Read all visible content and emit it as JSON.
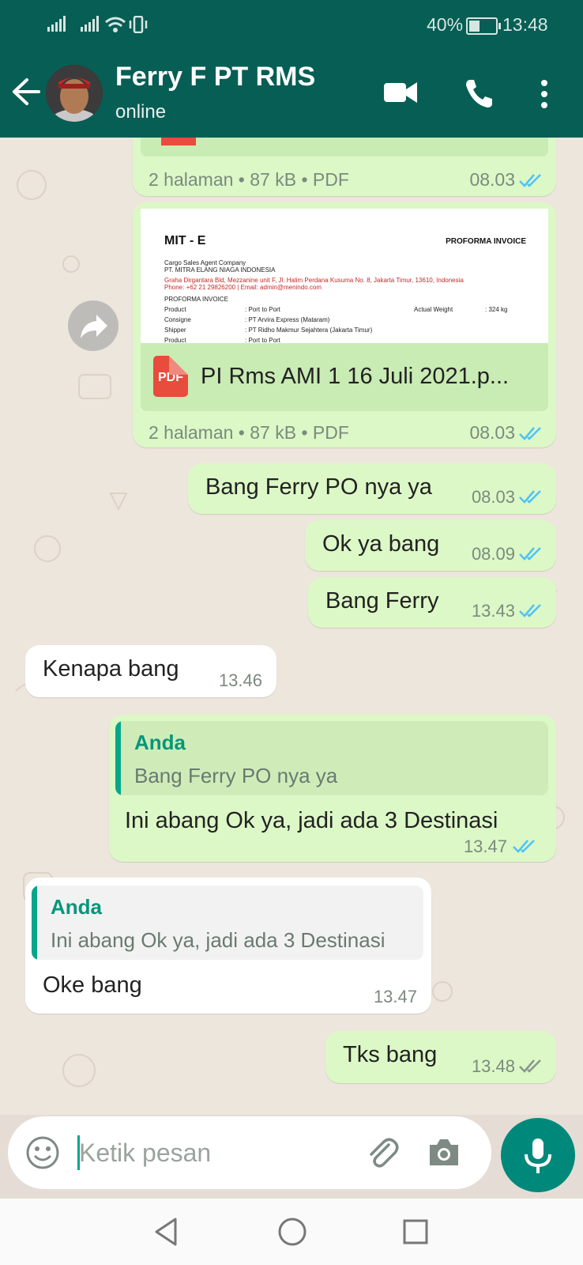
{
  "status_bar": {
    "battery": "40%",
    "time": "13:48",
    "battery_level": 0.4
  },
  "header": {
    "contact_name": "Ferry F PT RMS",
    "status": "online"
  },
  "messages": {
    "doc1": {
      "meta": "2 halaman • 87 kB • PDF",
      "time": "08.03"
    },
    "doc2": {
      "preview": {
        "logo": "MIT - E",
        "heading": "PROFORMA INVOICE",
        "line1": "Cargo Sales Agent Company",
        "line2": "PT. MITRA ELANG NIAGA INDONESIA",
        "address": "Graha Dirgantara Bld, Mezzanine unit F, Jl. Halim Perdana Kusuma No. 8, Jakarta Timur, 13610, Indonesia",
        "contact": "Phone: +62 21 29826200 | Email: admin@menindo.com",
        "subheading": "PROFORMA INVOICE",
        "rows": [
          {
            "label": "Product",
            "value": ": Port to Port"
          },
          {
            "label": "Consigne",
            "value": ": PT Arvira Express (Mataram)"
          },
          {
            "label": "Shipper",
            "value": ": PT Ridho Makmur Sejahtera (Jakarta Timur)"
          },
          {
            "label": "Product",
            "value": ": Port to Port"
          }
        ],
        "weight_label": "Actual Weight",
        "weight_value": ": 324 kg"
      },
      "pdf_label": "PDF",
      "filename": "PI Rms AMI 1 16 Juli 2021.p...",
      "meta": "2 halaman • 87 kB • PDF",
      "time": "08.03"
    },
    "m1": {
      "text": "Bang Ferry PO nya ya",
      "time": "08.03"
    },
    "m2": {
      "text": "Ok ya bang",
      "time": "08.09"
    },
    "m3": {
      "text": "Bang Ferry",
      "time": "13.43"
    },
    "m4": {
      "text": "Kenapa bang",
      "time": "13.46"
    },
    "m5": {
      "quote_author": "Anda",
      "quote_text": "Bang Ferry PO nya ya",
      "text": "Ini abang Ok ya, jadi ada 3 Destinasi",
      "time": "13.47"
    },
    "m6": {
      "quote_author": "Anda",
      "quote_text": "Ini abang Ok ya, jadi ada 3 Destinasi",
      "text": "Oke bang",
      "time": "13.47"
    },
    "m7": {
      "text": "Tks bang",
      "time": "13.48"
    }
  },
  "input": {
    "placeholder": "Ketik pesan"
  },
  "colors": {
    "header": "#075e54",
    "outgoing": "#dcf8c6",
    "incoming": "#ffffff",
    "accent": "#00897b",
    "read_ticks": "#4fc3f7"
  }
}
